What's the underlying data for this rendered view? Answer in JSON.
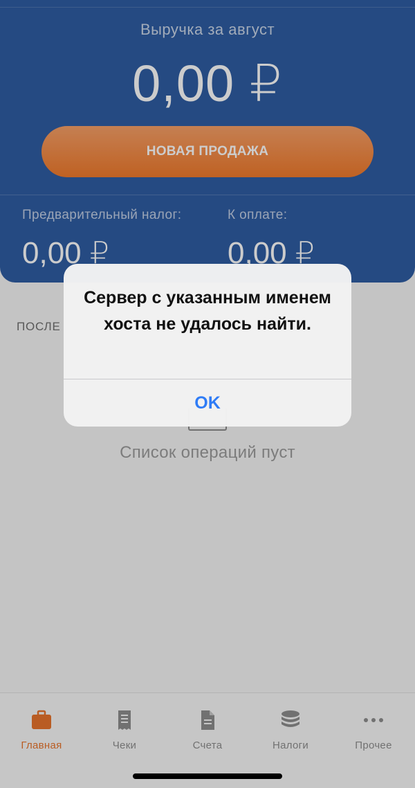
{
  "hero": {
    "subtitle": "Выручка за август",
    "amount": "0,00 ₽",
    "new_sale_label": "НОВАЯ ПРОДАЖА"
  },
  "stats": {
    "prelim_tax_label": "Предварительный налог:",
    "prelim_tax_value": "0,00 ₽",
    "to_pay_label": "К оплате:",
    "to_pay_value": "0,00 ₽"
  },
  "recent": {
    "title_visible": "ПОСЛЕ",
    "empty_text": "Список операций пуст"
  },
  "tabs": [
    {
      "label": "Главная",
      "icon": "briefcase-icon",
      "active": true
    },
    {
      "label": "Чеки",
      "icon": "receipt-icon",
      "active": false
    },
    {
      "label": "Счета",
      "icon": "document-icon",
      "active": false
    },
    {
      "label": "Налоги",
      "icon": "coins-icon",
      "active": false
    },
    {
      "label": "Прочее",
      "icon": "more-icon",
      "active": false
    }
  ],
  "alert": {
    "message": "Сервер с указанным именем хоста не удалось найти.",
    "ok_label": "OK"
  },
  "colors": {
    "hero_bg": "#2f5da3",
    "accent_orange": "#f07a2c",
    "ios_blue": "#2f7cf6"
  }
}
